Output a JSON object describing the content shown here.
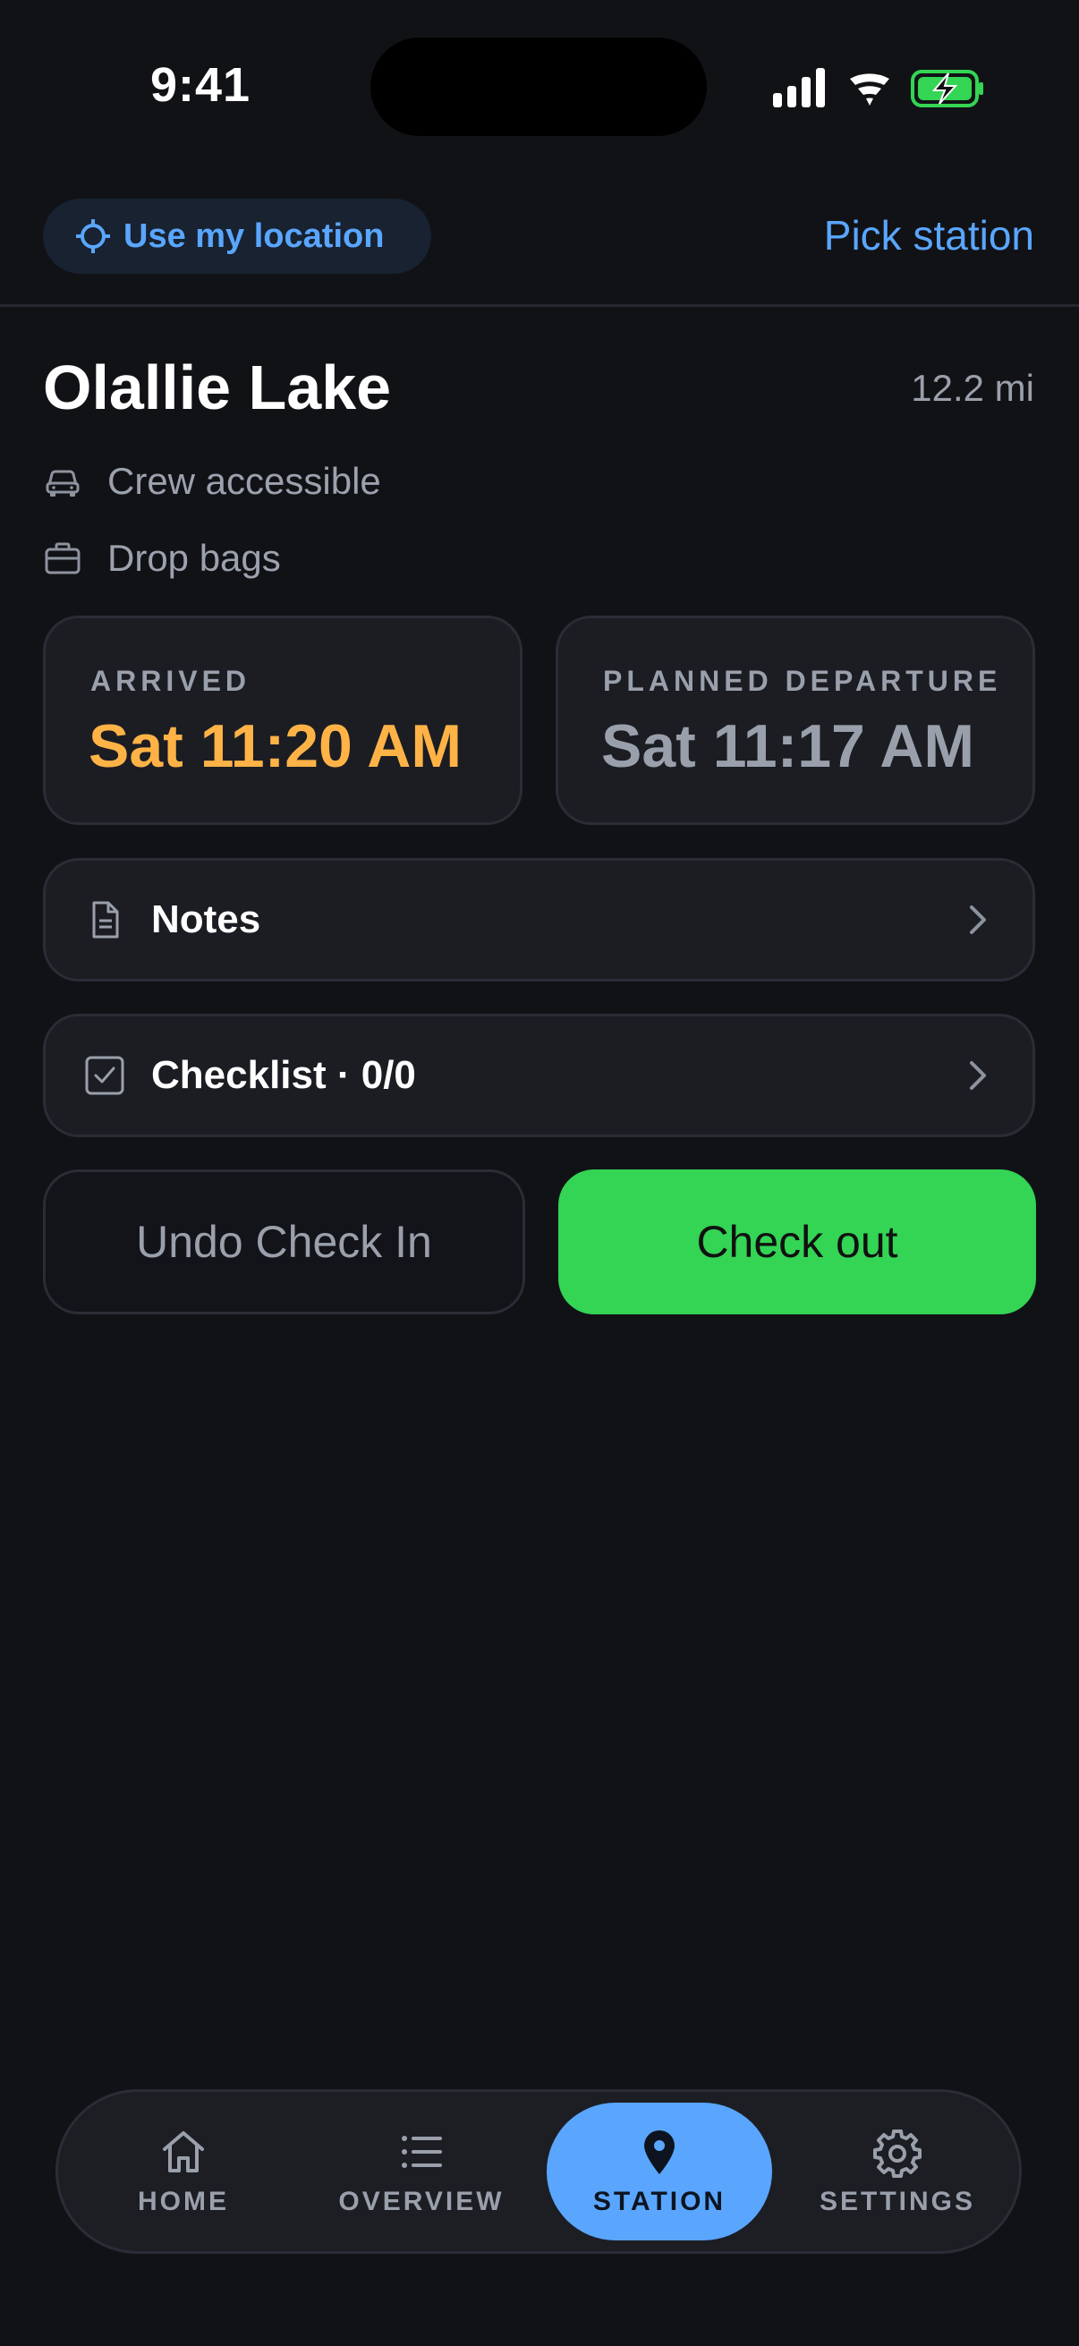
{
  "status_bar": {
    "time": "9:41",
    "icons": [
      "cellular-signal-icon",
      "wifi-icon",
      "battery-charging-icon"
    ]
  },
  "top_bar": {
    "use_location_label": "Use my location",
    "pick_station_label": "Pick station"
  },
  "station": {
    "name": "Olallie Lake",
    "distance": "12.2 mi",
    "attributes": [
      {
        "icon": "car-icon",
        "label": "Crew accessible"
      },
      {
        "icon": "briefcase-icon",
        "label": "Drop bags"
      }
    ]
  },
  "times": {
    "arrived_label": "ARRIVED",
    "arrived_value": "Sat 11:20 AM",
    "departure_label": "PLANNED DEPARTURE",
    "departure_value": "Sat 11:17 AM"
  },
  "rows": {
    "notes_label": "Notes",
    "checklist_label": "Checklist · 0/0"
  },
  "actions": {
    "undo_label": "Undo Check In",
    "checkout_label": "Check out"
  },
  "tabs": [
    {
      "label": "HOME",
      "icon": "home-icon"
    },
    {
      "label": "OVERVIEW",
      "icon": "list-icon"
    },
    {
      "label": "STATION",
      "icon": "map-pin-icon",
      "active": true
    },
    {
      "label": "SETTINGS",
      "icon": "gear-icon"
    }
  ],
  "colors": {
    "background": "#111216",
    "accent_blue": "#5aa6ff",
    "arrived_orange": "#ffb347",
    "checkout_green": "#34d454"
  }
}
